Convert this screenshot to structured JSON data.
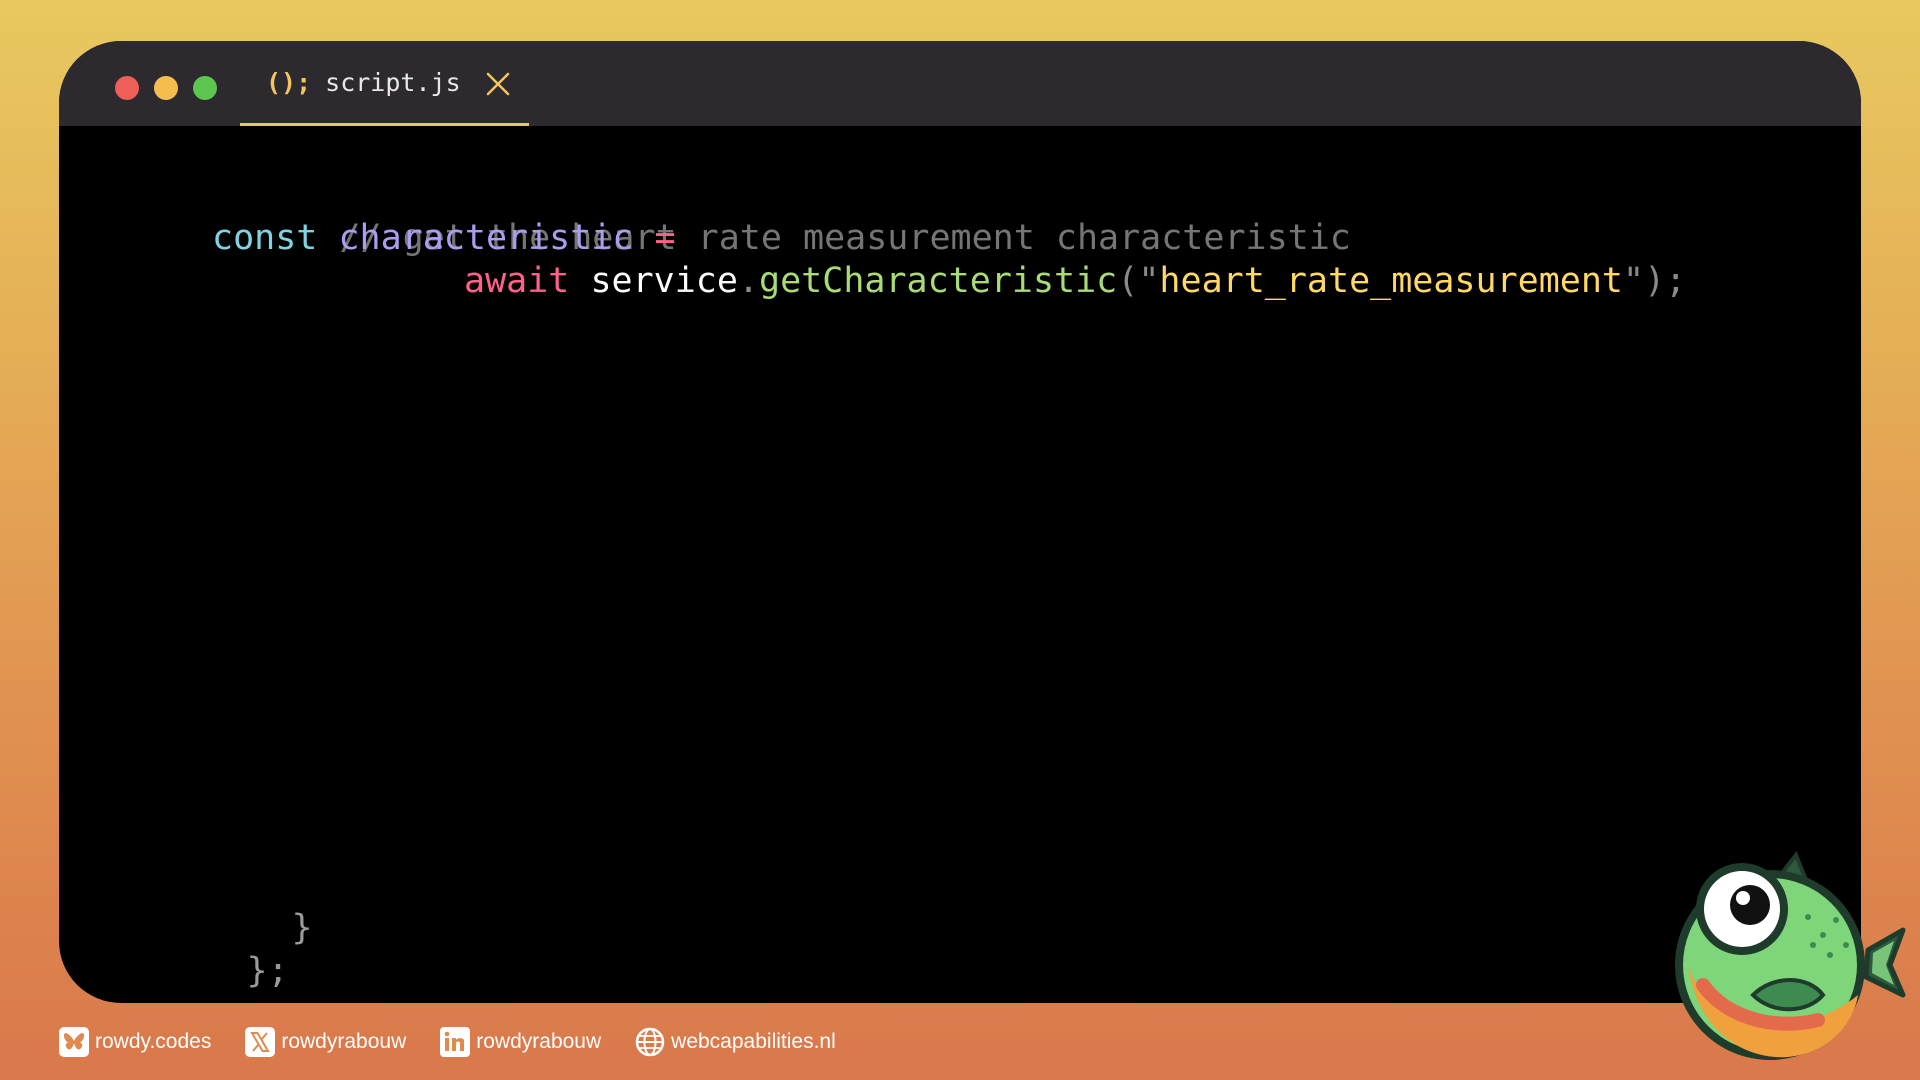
{
  "tab": {
    "icon_text": "();",
    "label": "script.js"
  },
  "code": {
    "comment": "// get the heart rate measurement characteristic",
    "const_kw": "const",
    "var_name": "characteristic",
    "assign": "=",
    "await_kw": "await",
    "object": "service",
    "dot": ".",
    "method": "getCharacteristic",
    "open_paren": "(\"",
    "string": "heart_rate_measurement",
    "close_paren": "\");",
    "inner_brace": "}",
    "outer_brace": "};"
  },
  "footer": {
    "bluesky": "rowdy.codes",
    "x": "rowdyrabouw",
    "linkedin": "rowdyrabouw",
    "website": "webcapabilities.nl"
  },
  "colors": {
    "accent": "#f3c55f",
    "keyword": "#7fd3e2",
    "variable": "#ab9df2",
    "operator": "#ff6188",
    "function": "#a9dc76",
    "string": "#ffd866",
    "comment": "#757575"
  }
}
